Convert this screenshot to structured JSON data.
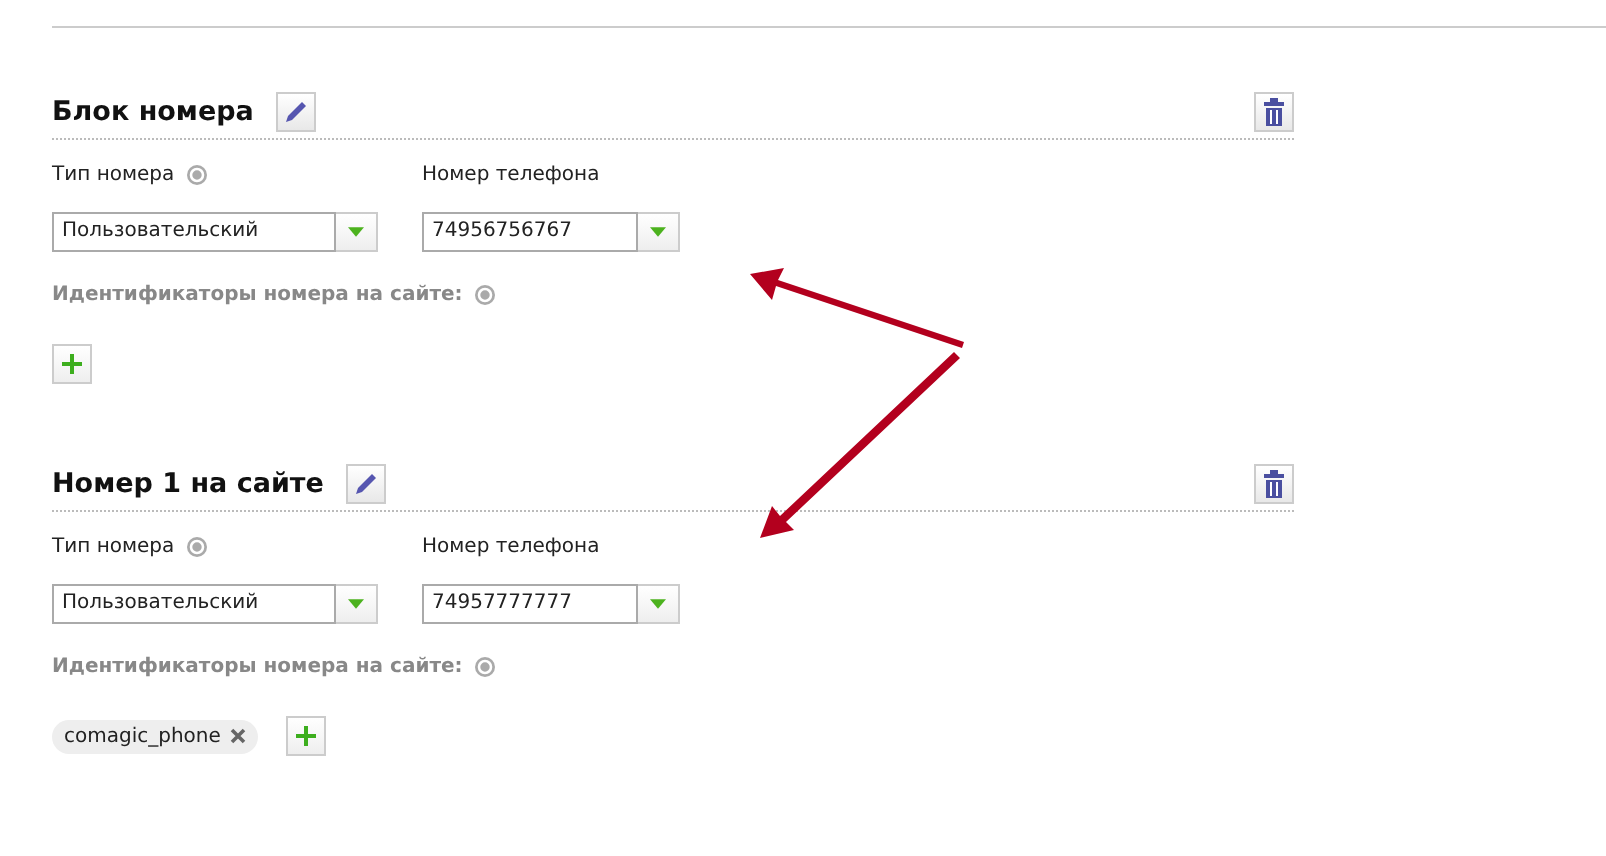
{
  "blocks": [
    {
      "title": "Блок номера",
      "fields": [
        {
          "label": "Тип номера",
          "help": true,
          "value": "Пользовательский"
        },
        {
          "label": "Номер телефона",
          "help": false,
          "value": "74956756767"
        }
      ],
      "identifiers_label": "Идентификаторы номера на сайте:"
    },
    {
      "title": "Номер 1 на сайте",
      "fields": [
        {
          "label": "Тип номера",
          "help": true,
          "value": "Пользовательский"
        },
        {
          "label": "Номер телефона",
          "help": false,
          "value": "74957777777"
        }
      ],
      "identifiers_label": "Идентификаторы номера на сайте:",
      "identifiers": [
        "comagic_phone"
      ]
    }
  ]
}
